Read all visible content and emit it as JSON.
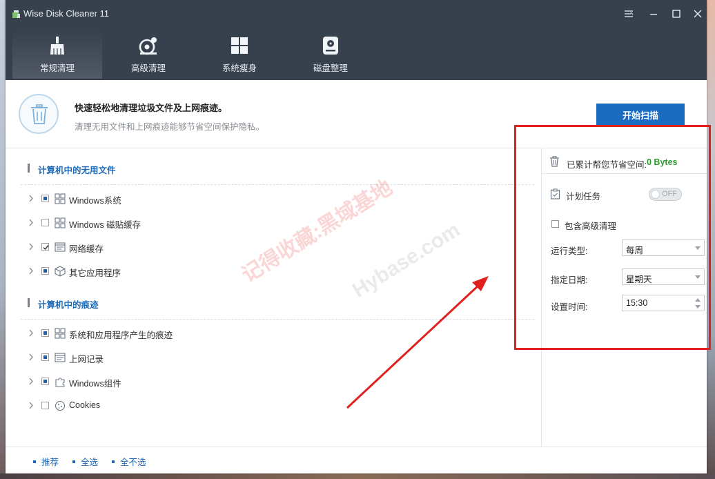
{
  "window": {
    "title": "Wise Disk Cleaner 11"
  },
  "tabs": [
    {
      "label": "常规清理",
      "icon": "broom-icon",
      "active": true
    },
    {
      "label": "高级清理",
      "icon": "advanced-clean-icon",
      "active": false
    },
    {
      "label": "系统瘦身",
      "icon": "windows-logo-icon",
      "active": false
    },
    {
      "label": "磁盘整理",
      "icon": "disk-drive-icon",
      "active": false
    }
  ],
  "header": {
    "title": "快速轻松地清理垃圾文件及上网痕迹。",
    "subtitle": "清理无用文件和上网痕迹能够节省空间保护隐私。",
    "scan_button": "开始扫描"
  },
  "sections": [
    {
      "title": "计算机中的无用文件",
      "items": [
        {
          "label": "Windows系统",
          "check": "partial",
          "icon": "windows-tiles-icon"
        },
        {
          "label": "Windows 磁贴缓存",
          "check": "none",
          "icon": "windows-tiles-icon"
        },
        {
          "label": "网络缓存",
          "check": "checked",
          "icon": "browser-window-icon"
        },
        {
          "label": "其它应用程序",
          "check": "partial",
          "icon": "package-box-icon"
        }
      ]
    },
    {
      "title": "计算机中的痕迹",
      "items": [
        {
          "label": "系统和应用程序产生的痕迹",
          "check": "partial",
          "icon": "windows-tiles-icon"
        },
        {
          "label": "上网记录",
          "check": "partial",
          "icon": "browser-window-icon"
        },
        {
          "label": "Windows组件",
          "check": "partial",
          "icon": "puzzle-piece-icon"
        },
        {
          "label": "Cookies",
          "check": "none",
          "icon": "cookie-icon"
        }
      ]
    }
  ],
  "right_panel": {
    "saved_label": "已累计帮您节省空间:",
    "saved_value": "0 Bytes",
    "schedule_label": "计划任务",
    "toggle_text": "OFF",
    "advanced_label": "包含高级清理",
    "run_type_label": "运行类型:",
    "run_type_value": "每周",
    "date_label": "指定日期:",
    "date_value": "星期天",
    "time_label": "设置时间:",
    "time_value": "15:30"
  },
  "footer": {
    "links": [
      "推荐",
      "全选",
      "全不选"
    ]
  },
  "watermark": {
    "line1": "记得收藏:黑域基地",
    "line2": "Hybase.com"
  },
  "colors": {
    "titlebar": "#37414e",
    "accent": "#1b6bc1",
    "saved_value": "#2e9a2e",
    "annotation": "#e0201c"
  }
}
